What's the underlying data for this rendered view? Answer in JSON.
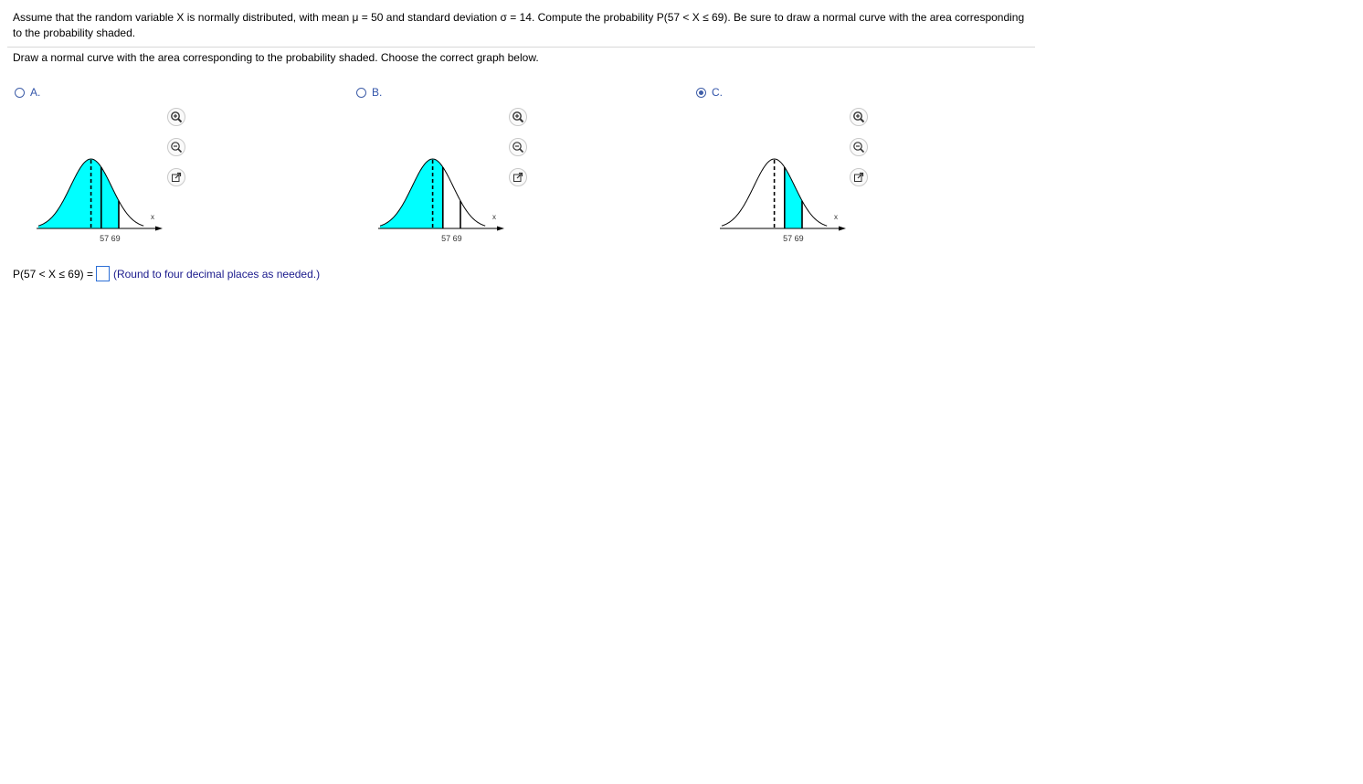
{
  "question": {
    "text": "Assume that the random variable X is normally distributed, with mean μ = 50 and standard deviation σ = 14. Compute the probability P(57 < X ≤ 69). Be sure to draw a normal curve with the area corresponding to the probability shaded."
  },
  "instruction": "Draw a normal curve with the area corresponding to the probability shaded. Choose the correct graph below.",
  "options": [
    {
      "label": "A.",
      "selected": false,
      "shading": "left of 69",
      "tick_labels": "57 69",
      "x_label": "x"
    },
    {
      "label": "B.",
      "selected": false,
      "shading": "left of 57",
      "tick_labels": "57 69",
      "x_label": "x"
    },
    {
      "label": "C.",
      "selected": true,
      "shading": "between 57 and 69",
      "tick_labels": "57 69",
      "x_label": "x"
    }
  ],
  "colors": {
    "shade": "#00ffff",
    "accent": "#3355aa",
    "input_border": "#2d6fd6"
  },
  "tool_icons": [
    "zoom-in-icon",
    "zoom-out-icon",
    "popout-icon"
  ],
  "answer": {
    "prompt": "P(57 < X ≤ 69) =",
    "value": "",
    "hint": "(Round to four decimal places as needed.)"
  }
}
